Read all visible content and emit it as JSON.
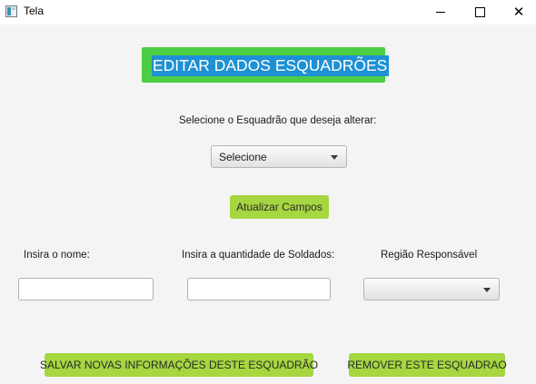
{
  "window": {
    "title": "Tela",
    "icon": "java-app-icon",
    "controls": [
      "minimize-icon",
      "maximize-icon",
      "close-icon"
    ]
  },
  "header": {
    "title": "EDITAR DADOS ESQUADRÕES",
    "background_color": "#4ccd44",
    "highlight_color": "#1e91d4"
  },
  "squad_selection": {
    "label": "Selecione o Esquadrão que deseja alterar:",
    "selected_value": "Selecione"
  },
  "update_button": {
    "label": "Atualizar Campos"
  },
  "form": {
    "name_label": "Insira o nome:",
    "name_value": "",
    "soldiers_label": "Insira a quantidade de Soldados:",
    "soldiers_value": "",
    "region_label": "Região Responsável",
    "region_selected": ""
  },
  "actions": {
    "save_label": "SALVAR NOVAS INFORMAÇÕES DESTE ESQUADRÃO",
    "remove_label": "REMOVER ESTE ESQUADRAO",
    "button_color": "#a6d640"
  }
}
